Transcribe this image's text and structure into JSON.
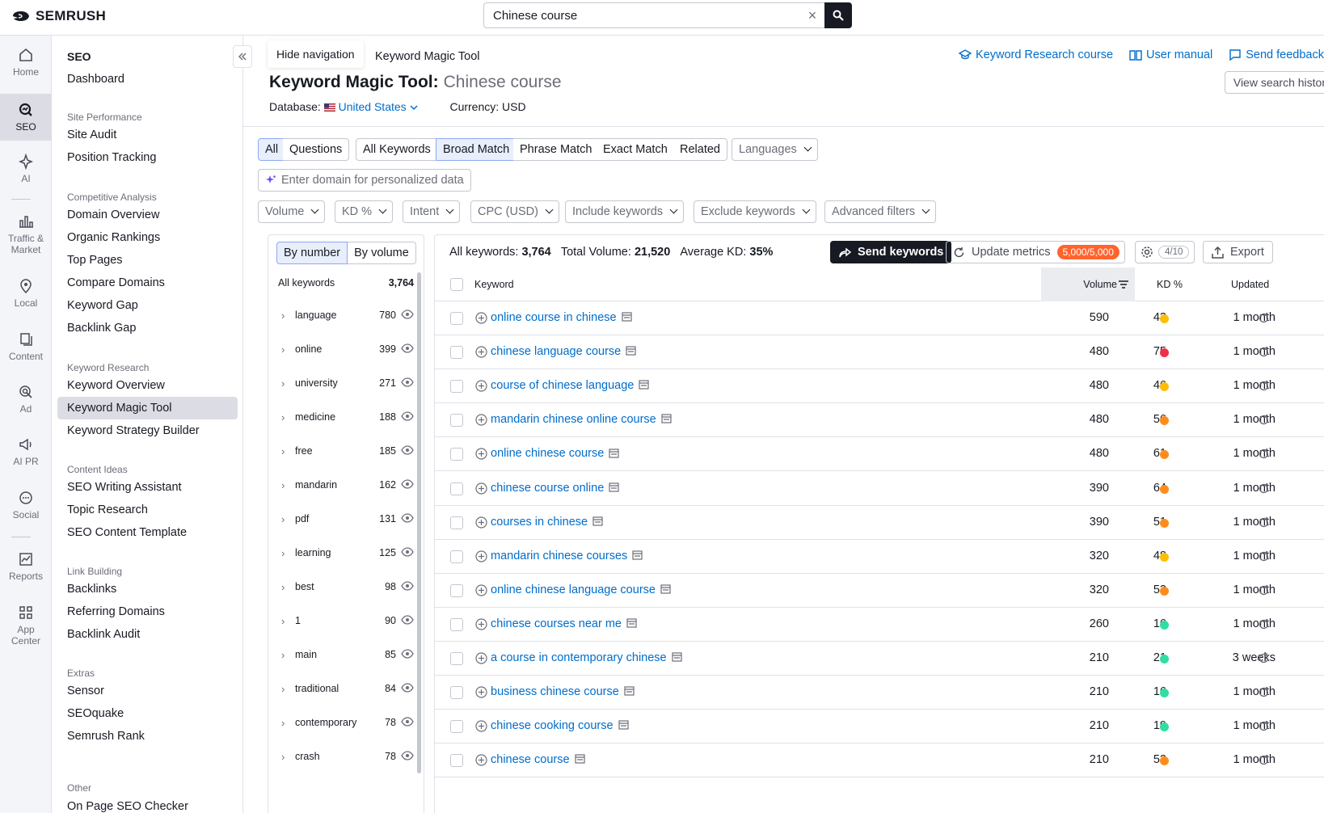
{
  "app": {
    "logo": "SEMRUSH"
  },
  "search": {
    "value": "Chinese course",
    "clear_label": "×"
  },
  "rail": [
    {
      "label": "Home",
      "icon": "home-icon"
    },
    {
      "label": "SEO",
      "icon": "seo-icon",
      "active": true
    },
    {
      "label": "AI",
      "icon": "ai-icon"
    },
    {
      "label": "Traffic & Market",
      "icon": "traffic-icon"
    },
    {
      "label": "Local",
      "icon": "local-pin-icon"
    },
    {
      "label": "Content",
      "icon": "content-icon"
    },
    {
      "label": "Ad",
      "icon": "ad-icon"
    },
    {
      "label": "AI PR",
      "icon": "megaphone-icon"
    },
    {
      "label": "Social",
      "icon": "social-chat-icon"
    },
    {
      "label": "Reports",
      "icon": "reports-icon"
    },
    {
      "label": "App Center",
      "icon": "app-grid-icon"
    }
  ],
  "sidenav": {
    "title": "SEO",
    "dashboard": "Dashboard",
    "groups": [
      {
        "label": "Site Performance",
        "items": [
          "Site Audit",
          "Position Tracking"
        ]
      },
      {
        "label": "Competitive Analysis",
        "items": [
          "Domain Overview",
          "Organic Rankings",
          "Top Pages",
          "Compare Domains",
          "Keyword Gap",
          "Backlink Gap"
        ]
      },
      {
        "label": "Keyword Research",
        "items": [
          "Keyword Overview",
          "Keyword Magic Tool",
          "Keyword Strategy Builder"
        ]
      },
      {
        "label": "Content Ideas",
        "items": [
          "SEO Writing Assistant",
          "Topic Research",
          "SEO Content Template"
        ]
      },
      {
        "label": "Link Building",
        "items": [
          "Backlinks",
          "Referring Domains",
          "Backlink Audit"
        ]
      },
      {
        "label": "Extras",
        "items": [
          "Sensor",
          "SEOquake",
          "Semrush Rank"
        ]
      },
      {
        "label": "Other",
        "items": [
          "On Page SEO Checker"
        ]
      }
    ],
    "active_item": "Keyword Magic Tool"
  },
  "header": {
    "hide_nav": "Hide navigation",
    "breadcrumb": "Keyword Magic Tool",
    "links": [
      "Keyword Research course",
      "User manual",
      "Send feedback"
    ],
    "title": "Keyword Magic Tool:",
    "query": "Chinese course",
    "database_label": "Database:",
    "database_value": "United States",
    "currency": "Currency: USD",
    "view_history": "View search history"
  },
  "tabs": {
    "all": "All",
    "questions": "Questions",
    "all_keywords": "All Keywords",
    "broad": "Broad Match",
    "phrase": "Phrase Match",
    "exact": "Exact Match",
    "related": "Related",
    "languages": "Languages"
  },
  "personalize_placeholder": "Enter domain for personalized data",
  "filters": [
    "Volume",
    "KD %",
    "Intent",
    "CPC (USD)",
    "Include keywords",
    "Exclude keywords",
    "Advanced filters"
  ],
  "left_panel": {
    "by_number": "By number",
    "by_volume": "By volume",
    "all_label": "All keywords",
    "all_count": "3,764",
    "groups": [
      {
        "name": "language",
        "count": "780"
      },
      {
        "name": "online",
        "count": "399"
      },
      {
        "name": "university",
        "count": "271"
      },
      {
        "name": "medicine",
        "count": "188"
      },
      {
        "name": "free",
        "count": "185"
      },
      {
        "name": "mandarin",
        "count": "162"
      },
      {
        "name": "pdf",
        "count": "131"
      },
      {
        "name": "learning",
        "count": "125"
      },
      {
        "name": "best",
        "count": "98"
      },
      {
        "name": "1",
        "count": "90"
      },
      {
        "name": "main",
        "count": "85"
      },
      {
        "name": "traditional",
        "count": "84"
      },
      {
        "name": "contemporary",
        "count": "78"
      },
      {
        "name": "crash",
        "count": "78"
      }
    ]
  },
  "table": {
    "all_keywords_label": "All keywords:",
    "all_keywords": "3,764",
    "total_volume_label": "Total Volume:",
    "total_volume": "21,520",
    "avg_kd_label": "Average KD:",
    "avg_kd": "35%",
    "send_keywords": "Send keywords",
    "update_metrics": "Update metrics",
    "credits": "5,000/5,000",
    "columns_count": "4/10",
    "export": "Export",
    "headers": {
      "keyword": "Keyword",
      "volume": "Volume",
      "kd": "KD %",
      "updated": "Updated"
    },
    "rows": [
      {
        "keyword": "online course in chinese",
        "volume": "590",
        "kd": "43",
        "kd_color": "#ffbd03",
        "updated": "1 month"
      },
      {
        "keyword": "chinese language course",
        "volume": "480",
        "kd": "75",
        "kd_color": "#f02f45",
        "updated": "1 month"
      },
      {
        "keyword": "course of chinese language",
        "volume": "480",
        "kd": "46",
        "kd_color": "#ffbd03",
        "updated": "1 month"
      },
      {
        "keyword": "mandarin chinese online course",
        "volume": "480",
        "kd": "56",
        "kd_color": "#ff8c1a",
        "updated": "1 month"
      },
      {
        "keyword": "online chinese course",
        "volume": "480",
        "kd": "61",
        "kd_color": "#ff8c1a",
        "updated": "1 month"
      },
      {
        "keyword": "chinese course online",
        "volume": "390",
        "kd": "64",
        "kd_color": "#ff8c1a",
        "updated": "1 month"
      },
      {
        "keyword": "courses in chinese",
        "volume": "390",
        "kd": "51",
        "kd_color": "#ff8c1a",
        "updated": "1 month"
      },
      {
        "keyword": "mandarin chinese courses",
        "volume": "320",
        "kd": "48",
        "kd_color": "#ffbd03",
        "updated": "1 month"
      },
      {
        "keyword": "online chinese language course",
        "volume": "320",
        "kd": "53",
        "kd_color": "#ff8c1a",
        "updated": "1 month"
      },
      {
        "keyword": "chinese courses near me",
        "volume": "260",
        "kd": "16",
        "kd_color": "#2fdea0",
        "updated": "1 month"
      },
      {
        "keyword": "a course in contemporary chinese",
        "volume": "210",
        "kd": "21",
        "kd_color": "#2fdea0",
        "updated": "3 weeks"
      },
      {
        "keyword": "business chinese course",
        "volume": "210",
        "kd": "16",
        "kd_color": "#2fdea0",
        "updated": "1 month"
      },
      {
        "keyword": "chinese cooking course",
        "volume": "210",
        "kd": "19",
        "kd_color": "#2fdea0",
        "updated": "1 month"
      },
      {
        "keyword": "chinese course",
        "volume": "210",
        "kd": "52",
        "kd_color": "#ff8c1a",
        "updated": "1 month"
      }
    ]
  }
}
